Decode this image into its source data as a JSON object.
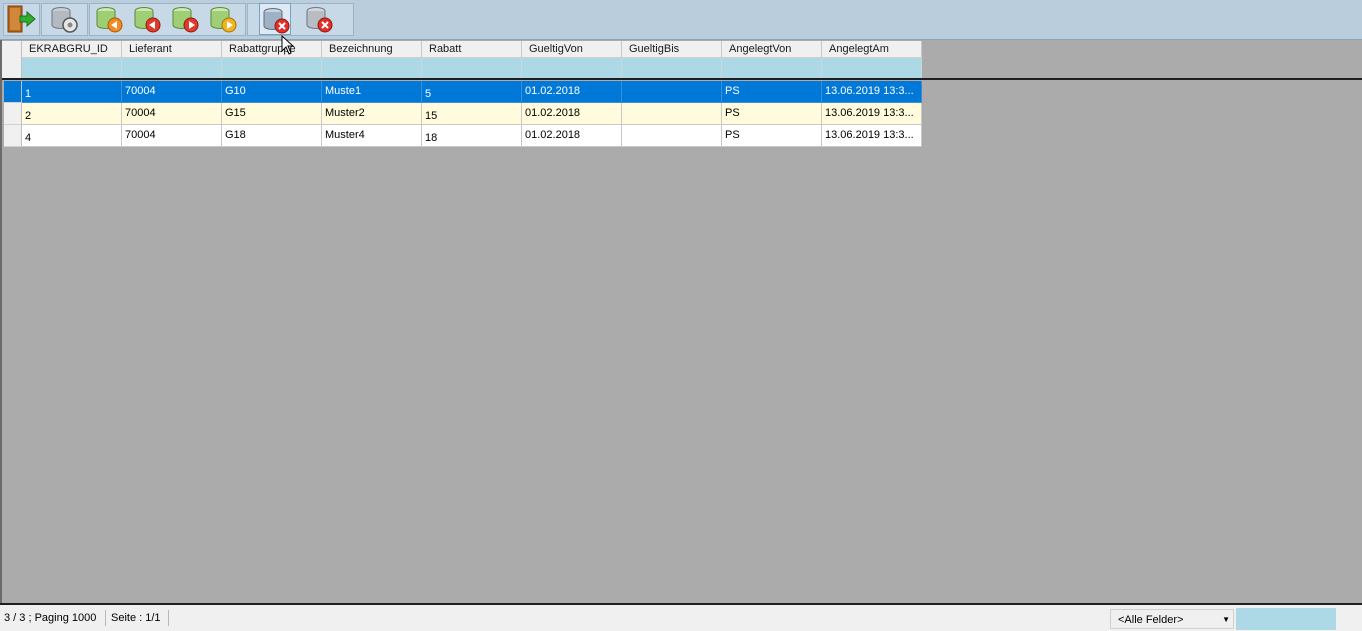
{
  "toolbar": {
    "buttons": [
      {
        "name": "exit",
        "icon": "exit-door-icon"
      },
      {
        "name": "settings",
        "icon": "db-gear-icon"
      },
      {
        "name": "first",
        "icon": "db-first-icon"
      },
      {
        "name": "previous",
        "icon": "db-prev-icon"
      },
      {
        "name": "next",
        "icon": "db-next-icon"
      },
      {
        "name": "last",
        "icon": "db-last-icon"
      },
      {
        "name": "delete",
        "icon": "db-delete-icon"
      },
      {
        "name": "delete-all",
        "icon": "db-delete-all-icon"
      }
    ]
  },
  "grid": {
    "columns": [
      "EKRABGRU_ID",
      "Lieferant",
      "Rabattgruppe",
      "Bezeichnung",
      "Rabatt",
      "GueltigVon",
      "GueltigBis",
      "AngelegtVon",
      "AngelegtAm"
    ],
    "rows": [
      [
        "1",
        "70004",
        "G10",
        "Muste1",
        "5",
        "01.02.2018",
        "",
        "PS",
        "13.06.2019 13:3..."
      ],
      [
        "2",
        "70004",
        "G15",
        "Muster2",
        "15",
        "01.02.2018",
        "",
        "PS",
        "13.06.2019 13:3..."
      ],
      [
        "4",
        "70004",
        "G18",
        "Muster4",
        "18",
        "01.02.2018",
        "",
        "PS",
        "13.06.2019 13:3..."
      ]
    ],
    "selected_row": 0
  },
  "status": {
    "record_info": "3 / 3 ; Paging 1000",
    "page_info": "Seite : 1/1",
    "field_select": "<Alle Felder>",
    "search_value": ""
  },
  "colors": {
    "selection": "#0078d7",
    "alt_row": "#fffbdc",
    "filter_row": "#add8e6",
    "grid_bg": "#ababab",
    "toolbar_bg": "#b9cddd"
  }
}
